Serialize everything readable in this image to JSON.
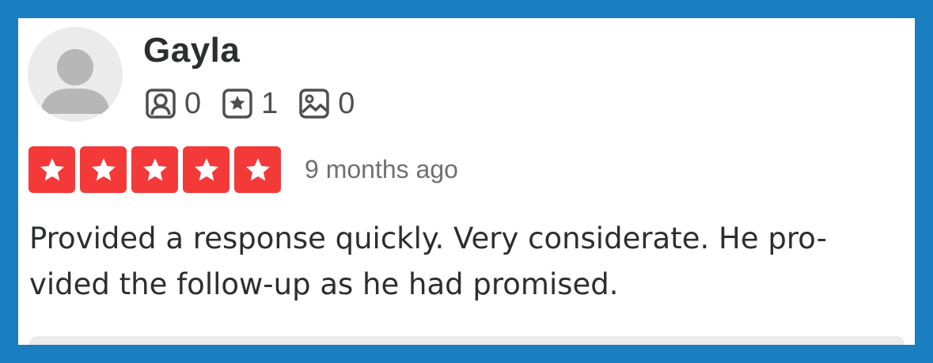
{
  "review": {
    "user_name": "Gayla",
    "stats": [
      {
        "icon": "friends-icon",
        "value": "0"
      },
      {
        "icon": "reviews-icon",
        "value": "1"
      },
      {
        "icon": "photos-icon",
        "value": "0"
      }
    ],
    "rating": 5,
    "date": "9 months ago",
    "text": "Provided a response quickly. Very considerate. He pro-vided the follow-up as he had promised."
  },
  "colors": {
    "frame": "#1a7fc0",
    "star_bg": "#f43939",
    "text": "#2d2e2f",
    "muted": "#6e7072"
  }
}
